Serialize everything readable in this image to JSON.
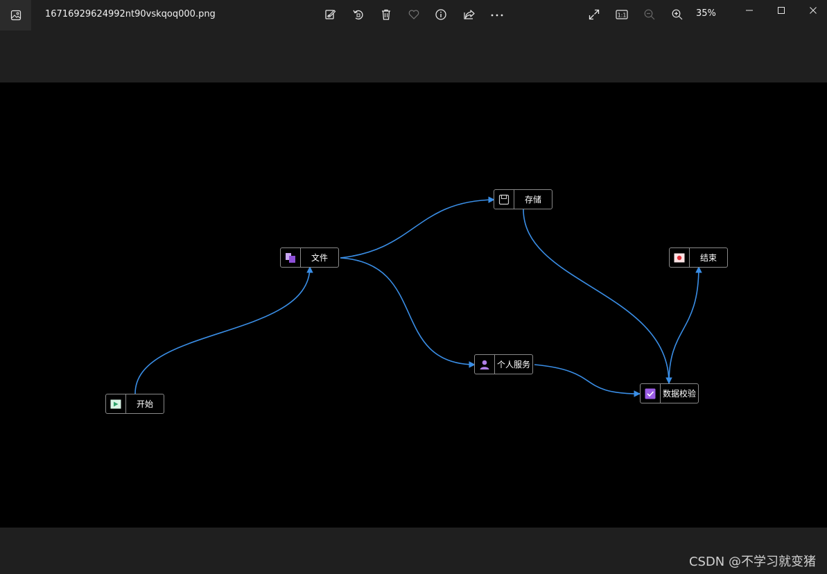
{
  "window": {
    "filename": "16716929624992nt90vskqoq000.png",
    "zoom": "35%",
    "toolbar_icons": [
      "edit-icon",
      "rotate-icon",
      "delete-icon",
      "favorite-icon",
      "info-icon",
      "share-icon",
      "more-icon"
    ],
    "view_icons": [
      "fullscreen-icon",
      "actual-size-icon",
      "zoom-out-icon",
      "zoom-in-icon"
    ],
    "actual_size_label": "1:1"
  },
  "diagram": {
    "nodes": [
      {
        "id": "start",
        "label": "开始",
        "icon": "play-icon",
        "color": "#4caf7a"
      },
      {
        "id": "file",
        "label": "文件",
        "icon": "files-icon",
        "color": "#a066e0"
      },
      {
        "id": "storage",
        "label": "存储",
        "icon": "save-icon",
        "color": "#cfcfcf"
      },
      {
        "id": "service",
        "label": "个人服务",
        "icon": "user-icon",
        "color": "#a066e0"
      },
      {
        "id": "verify",
        "label": "数据校验",
        "icon": "checkbox-icon",
        "color": "#9b5de5"
      },
      {
        "id": "end",
        "label": "结束",
        "icon": "stop-icon",
        "color": "#e0303a"
      }
    ],
    "edges": [
      {
        "from": "start",
        "to": "file"
      },
      {
        "from": "file",
        "to": "storage"
      },
      {
        "from": "file",
        "to": "service"
      },
      {
        "from": "storage",
        "to": "verify"
      },
      {
        "from": "service",
        "to": "verify"
      },
      {
        "from": "verify",
        "to": "end"
      }
    ],
    "edge_color": "#3a8ee6"
  },
  "watermark": "CSDN @不学习就变猪"
}
